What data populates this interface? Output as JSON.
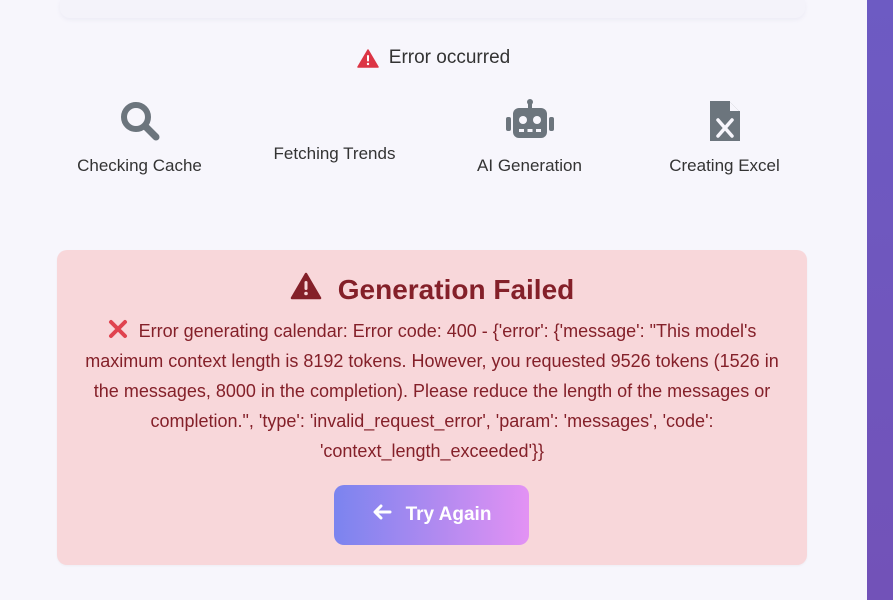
{
  "status": {
    "icon": "warning-triangle-icon",
    "text": "Error occurred",
    "icon_color": "#dc3545"
  },
  "steps": [
    {
      "label": "Checking Cache",
      "icon": "search-icon"
    },
    {
      "label": "Fetching Trends",
      "icon": ""
    },
    {
      "label": "AI Generation",
      "icon": "robot-icon"
    },
    {
      "label": "Creating Excel",
      "icon": "excel-file-icon"
    }
  ],
  "error_card": {
    "title": "Generation Failed",
    "title_icon": "warning-triangle-icon",
    "message_icon": "x-mark-icon",
    "message": "Error generating calendar: Error code: 400 - {'error': {'message': \"This model's maximum context length is 8192 tokens. However, you requested 9526 tokens (1526 in the messages, 8000 in the completion). Please reduce the length of the messages or completion.\", 'type': 'invalid_request_error', 'param': 'messages', 'code': 'context_length_exceeded'}}",
    "background": "#f8d7da",
    "text_color": "#842029"
  },
  "try_again": {
    "label": "Try Again",
    "icon": "arrow-left-icon"
  },
  "colors": {
    "step_icon": "#6c757d",
    "sidebar_accent": "#6d5bc3"
  }
}
